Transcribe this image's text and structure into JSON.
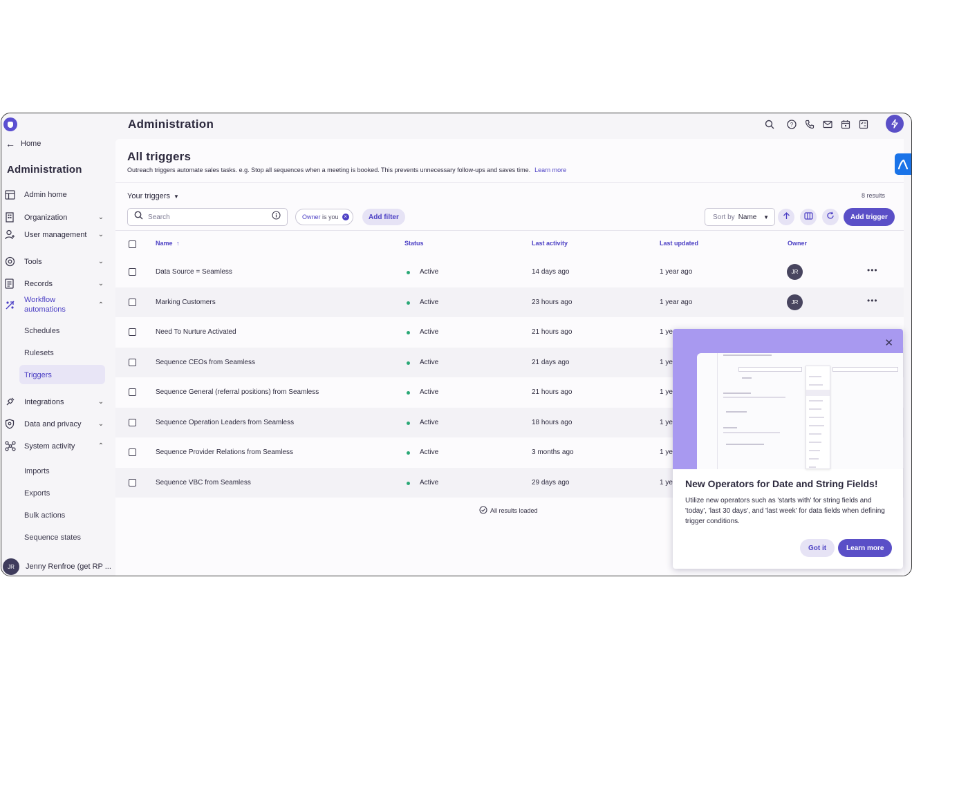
{
  "header": {
    "title": "Administration",
    "icons": [
      "search-icon",
      "help-icon",
      "phone-icon",
      "mail-icon",
      "calendar-icon",
      "tasks-icon",
      "bolt-icon"
    ]
  },
  "sidebar": {
    "home_label": "Home",
    "title": "Administration",
    "items": [
      {
        "label": "Admin home",
        "icon": "layout-icon"
      },
      {
        "label": "Organization",
        "icon": "building-icon"
      },
      {
        "label": "User management",
        "icon": "users-icon"
      },
      {
        "label": "Tools",
        "icon": "tools-icon"
      },
      {
        "label": "Records",
        "icon": "records-icon"
      },
      {
        "label": "Workflow automations",
        "icon": "workflow-icon"
      },
      {
        "label": "Integrations",
        "icon": "plug-icon"
      },
      {
        "label": "Data and privacy",
        "icon": "shield-icon"
      },
      {
        "label": "System activity",
        "icon": "activity-icon"
      }
    ],
    "workflow_sub": [
      "Schedules",
      "Rulesets",
      "Triggers"
    ],
    "system_sub": [
      "Imports",
      "Exports",
      "Bulk actions",
      "Sequence states"
    ],
    "user_initials": "JR",
    "user_name": "Jenny Renfroe (get RP ..."
  },
  "page": {
    "title": "All triggers",
    "description": "Outreach triggers automate sales tasks. e.g. Stop all sequences when a meeting is booked. This prevents unnecessary follow-ups and saves time.",
    "learn_more": "Learn more",
    "view_label": "Your triggers",
    "results": "8 results",
    "search_placeholder": "Search",
    "owner_chip_prefix": "Owner",
    "owner_chip_value": "is you",
    "add_filter": "Add filter",
    "sort_label": "Sort by",
    "sort_value": "Name",
    "add_trigger": "Add trigger",
    "all_loaded": "All results loaded"
  },
  "table": {
    "columns": [
      "Name",
      "Status",
      "Last activity",
      "Last updated",
      "Owner"
    ],
    "rows": [
      {
        "name": "Data Source = Seamless",
        "status": "Active",
        "last_activity": "14 days ago",
        "last_updated": "1 year ago",
        "owner": "JR"
      },
      {
        "name": "Marking Customers",
        "status": "Active",
        "last_activity": "23 hours ago",
        "last_updated": "1 year ago",
        "owner": "JR"
      },
      {
        "name": "Need To Nurture Activated",
        "status": "Active",
        "last_activity": "21 hours ago",
        "last_updated": "1 ye"
      },
      {
        "name": "Sequence CEOs from Seamless",
        "status": "Active",
        "last_activity": "21 days ago",
        "last_updated": "1 ye"
      },
      {
        "name": "Sequence General (referral positions) from Seamless",
        "status": "Active",
        "last_activity": "21 hours ago",
        "last_updated": "1 ye"
      },
      {
        "name": "Sequence Operation Leaders from Seamless",
        "status": "Active",
        "last_activity": "18 hours ago",
        "last_updated": "1 ye"
      },
      {
        "name": "Sequence Provider Relations from Seamless",
        "status": "Active",
        "last_activity": "3 months ago",
        "last_updated": "1 ye"
      },
      {
        "name": "Sequence VBC from Seamless",
        "status": "Active",
        "last_activity": "29 days ago",
        "last_updated": "1 ye"
      }
    ]
  },
  "popup": {
    "title": "New Operators for Date and String Fields!",
    "body": "Utilize new operators such as 'starts with' for string fields and 'today', 'last 30 days', and 'last week' for data fields when defining trigger conditions.",
    "got_it": "Got it",
    "learn_more": "Learn more"
  },
  "colors": {
    "accent": "#5a4fc7",
    "accent_text": "#4b3fc4",
    "status_active": "#2aa876",
    "popup_hero": "#a899f0"
  }
}
